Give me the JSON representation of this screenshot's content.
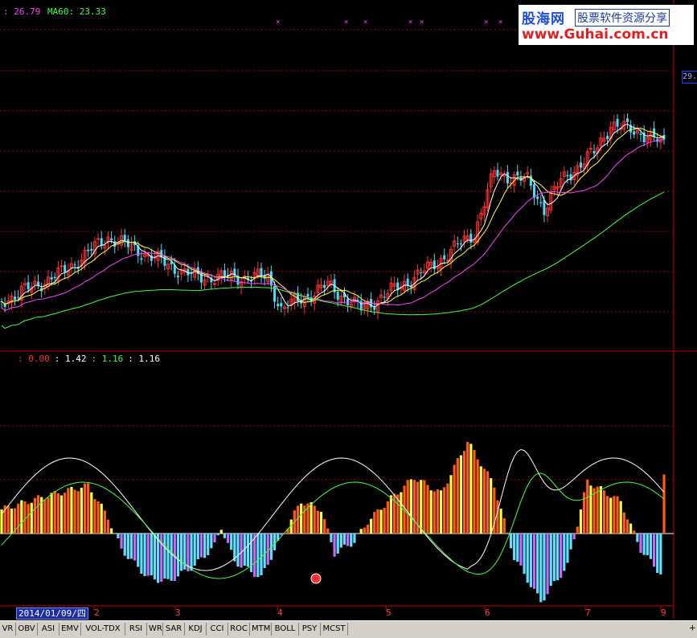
{
  "main_panel": {
    "ma_legend": [
      {
        "text": ": 26.79",
        "color": "#ff40ff"
      },
      {
        "text": "MA60: 23.33",
        "color": "#40ff40"
      }
    ],
    "price_tag": "29."
  },
  "indicator_panel": {
    "legend": [
      {
        "text": ": 0.00",
        "color": "#ff3030"
      },
      {
        "text": ": 1.42",
        "color": "#ffffff"
      },
      {
        "text": ": 1.16",
        "color": "#40ff40"
      },
      {
        "text": ": 1.16",
        "color": "#ffffff"
      }
    ]
  },
  "watermark": {
    "brand": "股海网",
    "tagline": "股票软件资源分享",
    "url": "www.Guhai.com.cn"
  },
  "x_axis": {
    "selected_date": "2014/01/09/四",
    "month_ticks": [
      "2",
      "3",
      "4",
      "5",
      "6",
      "7",
      "9"
    ]
  },
  "indicator_tabs": [
    "VR",
    "OBV",
    "ASI",
    "EMV",
    "VOL-TDX",
    "RSI",
    "WR",
    "SAR",
    "KDJ",
    "CCI",
    "ROC",
    "MTM",
    "BOLL",
    "PSY",
    "MCST"
  ],
  "colors": {
    "up": "#ff3030",
    "down": "#40e0ff",
    "ma_white": "#ffffff",
    "ma_yellow": "#ffff40",
    "ma_magenta": "#ff40ff",
    "ma_green": "#40ff40",
    "grid": "#a00000"
  }
}
